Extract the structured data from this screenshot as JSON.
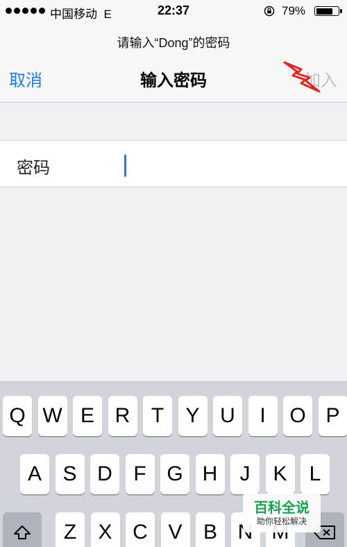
{
  "status_bar": {
    "carrier": "中国移动",
    "network": "E",
    "time": "22:37",
    "battery_percent": "79%",
    "battery_level": 0.79
  },
  "nav": {
    "prompt": "请输入“Dong”的密码",
    "cancel_label": "取消",
    "title": "输入密码",
    "join_label": "加入"
  },
  "form": {
    "password_label": "密码",
    "password_value": ""
  },
  "keyboard": {
    "row1": [
      "Q",
      "W",
      "E",
      "R",
      "T",
      "Y",
      "U",
      "I",
      "O",
      "P"
    ],
    "row2": [
      "A",
      "S",
      "D",
      "F",
      "G",
      "H",
      "J",
      "K",
      "L"
    ],
    "row3": [
      "Z",
      "X",
      "C",
      "V",
      "B",
      "N",
      "M"
    ],
    "shift_icon": "shift-icon",
    "delete_icon": "delete-icon"
  },
  "watermark": {
    "title": "百科全说",
    "subtitle": "助你轻松解决"
  },
  "colors": {
    "accent": "#1a7cf0",
    "disabled": "#c0c0c4",
    "caret": "#3a6fe0",
    "annotation": "#e32222",
    "watermark_green": "#16a34a"
  }
}
